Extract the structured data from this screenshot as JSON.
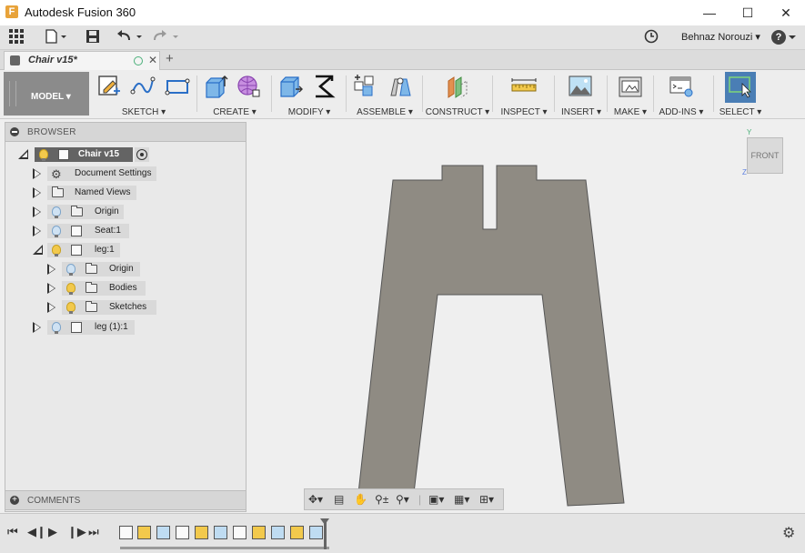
{
  "window": {
    "title": "Autodesk Fusion 360"
  },
  "user": {
    "name": "Behnaz Norouzi ▾"
  },
  "document_tab": {
    "label": "Chair v15*"
  },
  "workspace": {
    "label": "MODEL ▾"
  },
  "ribbon": {
    "groups": [
      {
        "label": "SKETCH ▾"
      },
      {
        "label": "CREATE ▾"
      },
      {
        "label": "MODIFY ▾"
      },
      {
        "label": "ASSEMBLE ▾"
      },
      {
        "label": "CONSTRUCT ▾"
      },
      {
        "label": "INSPECT ▾"
      },
      {
        "label": "INSERT ▾"
      },
      {
        "label": "MAKE ▾"
      },
      {
        "label": "ADD-INS ▾"
      },
      {
        "label": "SELECT ▾"
      }
    ]
  },
  "browser": {
    "title": "BROWSER",
    "root": {
      "label": "Chair v15"
    },
    "items": [
      {
        "label": "Document Settings",
        "icon": "gear-icon"
      },
      {
        "label": "Named Views",
        "icon": "folder-icon"
      },
      {
        "label": "Origin",
        "icon": "folder-icon"
      },
      {
        "label": "Seat:1",
        "icon": "component-icon"
      },
      {
        "label": "leg:1",
        "icon": "component-icon"
      },
      {
        "label": "Origin",
        "icon": "folder-icon"
      },
      {
        "label": "Bodies",
        "icon": "folder-icon"
      },
      {
        "label": "Sketches",
        "icon": "folder-icon"
      },
      {
        "label": "leg (1):1",
        "icon": "component-icon"
      }
    ]
  },
  "comments": {
    "title": "COMMENTS"
  },
  "viewcube": {
    "face": "FRONT",
    "axis_y": "Y",
    "axis_z": "Z"
  },
  "colors": {
    "body": "#8f8b83",
    "workspace": "#8b8b8b",
    "select_active": "#4a7eb5"
  }
}
